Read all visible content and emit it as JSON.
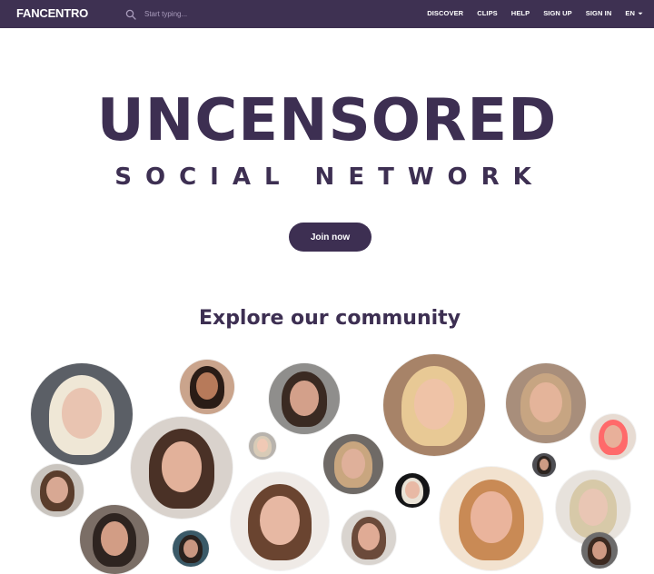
{
  "header": {
    "logo": "FANCENTRO",
    "search_placeholder": "Start typing...",
    "nav": [
      "DISCOVER",
      "CLIPS",
      "HELP",
      "SIGN UP",
      "SIGN IN"
    ],
    "language": "EN"
  },
  "hero": {
    "title": "UNCENSORED",
    "subtitle": "SOCIAL NETWORK",
    "cta": "Join now"
  },
  "community": {
    "heading": "Explore our community",
    "profiles": [
      {
        "id": "creator-1",
        "bg": "#5b5f66",
        "hair": "#efe7d6",
        "skin": "#e9c4b1"
      },
      {
        "id": "creator-2",
        "bg": "#caa48c",
        "hair": "#2a1c16",
        "skin": "#b77a5a"
      },
      {
        "id": "creator-3",
        "bg": "#8f8e8c",
        "hair": "#3a2a22",
        "skin": "#d3a08a"
      },
      {
        "id": "creator-4",
        "bg": "#a78368",
        "hair": "#e8c995",
        "skin": "#efc3a7"
      },
      {
        "id": "creator-5",
        "bg": "#a88e7b",
        "hair": "#c7a582",
        "skin": "#e4b49a"
      },
      {
        "id": "creator-6",
        "bg": "#e7dbd2",
        "hair": "#ff6a6a",
        "skin": "#e8b09a"
      },
      {
        "id": "creator-7",
        "bg": "#d9d2cc",
        "hair": "#4a3126",
        "skin": "#e2b19a"
      },
      {
        "id": "creator-8",
        "bg": "#b8b3ad",
        "hair": "#d8cbb7",
        "skin": "#f0c9b5"
      },
      {
        "id": "creator-9",
        "bg": "#6f6a66",
        "hair": "#c9a67f",
        "skin": "#dfb09a"
      },
      {
        "id": "creator-10",
        "bg": "#4d4d52",
        "hair": "#2c2420",
        "skin": "#cc9b84"
      },
      {
        "id": "creator-11",
        "bg": "#c9c4be",
        "hair": "#5a3d2c",
        "skin": "#d8a893"
      },
      {
        "id": "creator-12",
        "bg": "#141416",
        "hair": "#e9e2d6",
        "skin": "#e8b9a5"
      },
      {
        "id": "creator-13",
        "bg": "#efeae6",
        "hair": "#6a4430",
        "skin": "#e7b8a3"
      },
      {
        "id": "creator-14",
        "bg": "#f2e2cf",
        "hair": "#c98a55",
        "skin": "#eab49c"
      },
      {
        "id": "creator-15",
        "bg": "#e7e2dc",
        "hair": "#d7c9a8",
        "skin": "#e9c6b4"
      },
      {
        "id": "creator-16",
        "bg": "#7b6e66",
        "hair": "#2e2420",
        "skin": "#d29d85"
      },
      {
        "id": "creator-17",
        "bg": "#d9d4cf",
        "hair": "#6b4a3a",
        "skin": "#e0ab95"
      },
      {
        "id": "creator-18",
        "bg": "#3b5a68",
        "hair": "#2a221f",
        "skin": "#c99782"
      },
      {
        "id": "creator-19",
        "bg": "#6c6b6b",
        "hair": "#3d2a20",
        "skin": "#cf9a83"
      }
    ]
  },
  "colors": {
    "brand": "#3e3152",
    "text": "#3d2f52",
    "background": "#ffffff"
  }
}
